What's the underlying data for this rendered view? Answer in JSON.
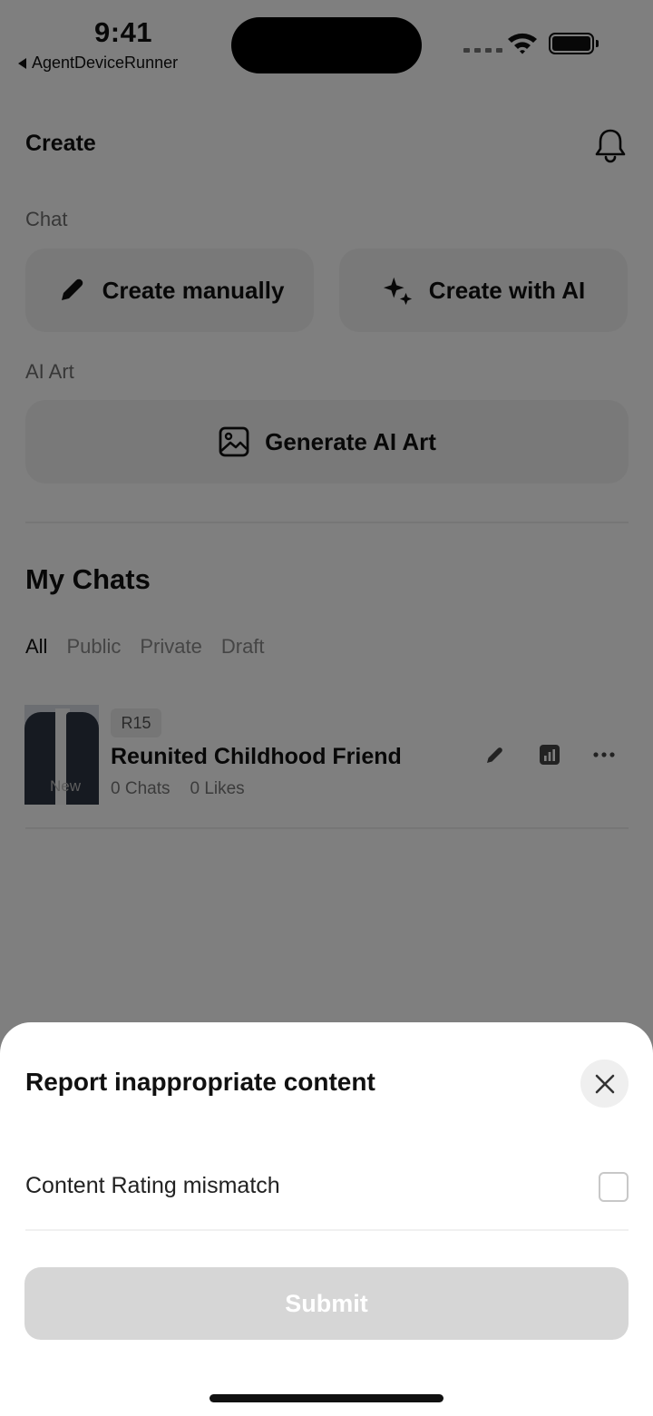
{
  "status_bar": {
    "time": "9:41",
    "back_app": "AgentDeviceRunner"
  },
  "header": {
    "title": "Create",
    "bell_icon": "bell-icon"
  },
  "chat_section": {
    "label": "Chat",
    "create_manually": "Create manually",
    "create_with_ai": "Create with AI"
  },
  "art_section": {
    "label": "AI Art",
    "generate": "Generate AI Art"
  },
  "my_chats": {
    "title": "My Chats",
    "tabs": [
      {
        "label": "All",
        "active": true
      },
      {
        "label": "Public",
        "active": false
      },
      {
        "label": "Private",
        "active": false
      },
      {
        "label": "Draft",
        "active": false
      }
    ],
    "items": [
      {
        "rating": "R15",
        "thumb_tag": "New",
        "title": "Reunited Childhood Friend",
        "chats": "0 Chats",
        "likes": "0 Likes"
      }
    ]
  },
  "report_sheet": {
    "title": "Report inappropriate content",
    "option": "Content Rating mismatch",
    "option_checked": false,
    "submit": "Submit",
    "submit_enabled": false
  },
  "colors": {
    "overlay": "#000000",
    "submit_disabled": "#d6d6d6",
    "button_bg": "#f3f3f3"
  }
}
